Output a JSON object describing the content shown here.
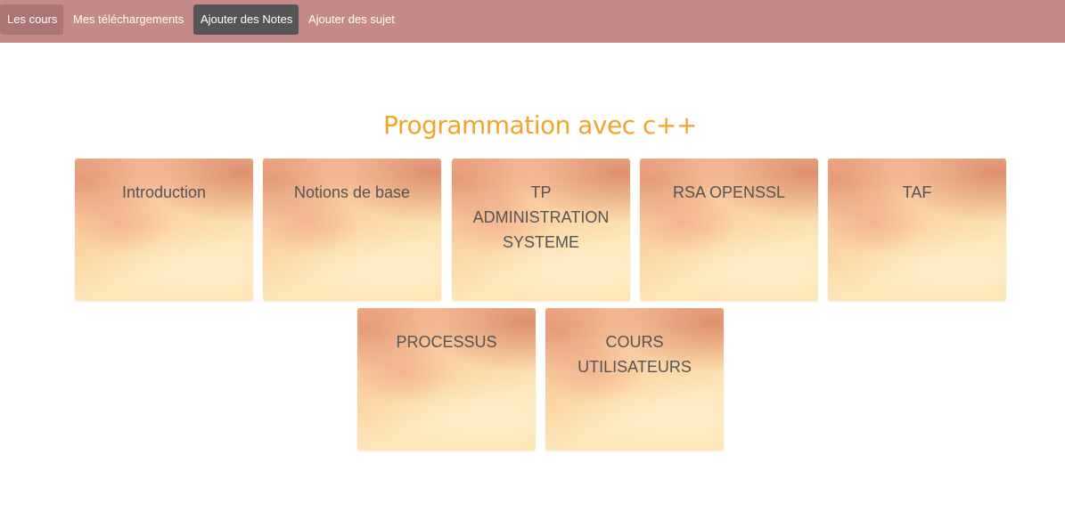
{
  "navbar": {
    "items": [
      {
        "label": "Les cours"
      },
      {
        "label": "Mes téléchargements"
      },
      {
        "label": "Ajouter des Notes"
      },
      {
        "label": "Ajouter des sujet"
      }
    ],
    "color": "#c58a87"
  },
  "section": {
    "title": "Programmation avec c++",
    "title_color": "#f0a52a"
  },
  "cards": [
    {
      "label": "Introduction"
    },
    {
      "label": "Notions de base"
    },
    {
      "label": "TP ADMINISTRATION SYSTEME"
    },
    {
      "label": "RSA OPENSSL"
    },
    {
      "label": "TAF"
    },
    {
      "label": "PROCESSUS"
    },
    {
      "label": "COURS UTILISATEURS"
    }
  ]
}
